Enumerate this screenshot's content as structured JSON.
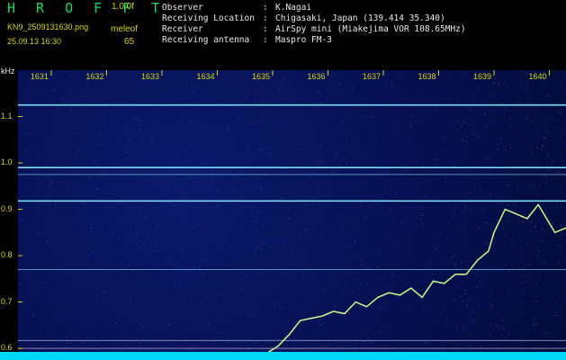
{
  "header": {
    "app_title": "H R O F F T",
    "version": "1.0.0f",
    "filename": "KN9_2509131630.png",
    "datetime": "25.09.13 16:30",
    "mode_label": "meleof",
    "mode_value": "65"
  },
  "info": [
    {
      "label": "Observer",
      "value": "K.Nagai"
    },
    {
      "label": "Receiving Location",
      "value": "Chigasaki, Japan (139.414 35.340)"
    },
    {
      "label": "Receiver",
      "value": "AirSpy mini (Miakejima VOR 108.65MHz)"
    },
    {
      "label": "Receiving antenna",
      "value": "Maspro FM-3"
    }
  ],
  "colors": {
    "background": "#000000",
    "plot_background": "#061052",
    "trace": "#c8ff80",
    "lines": "#80e8ff",
    "text_yellow": "#d8d800",
    "text_white": "#e8e8e8",
    "baseline": "#00d8f8"
  },
  "chart_data": {
    "type": "heatmap",
    "title": "",
    "xlabel": "",
    "ylabel": "kHz",
    "x_ticks": [
      "1631",
      "1632",
      "1633",
      "1634",
      "1635",
      "1636",
      "1637",
      "1638",
      "1639",
      "1640"
    ],
    "y_ticks": [
      "1.1",
      "1.0",
      "0.9",
      "0.8",
      "0.7",
      "0.6"
    ],
    "ylim": [
      0.575,
      1.2
    ],
    "xlim": [
      1630.4,
      1640.3
    ],
    "horizontal_lines_khz": [
      1.125,
      0.99,
      0.975,
      0.918,
      0.77,
      0.617,
      0.6
    ],
    "trace": {
      "x": [
        1634.7,
        1634.9,
        1635.1,
        1635.3,
        1635.5,
        1635.7,
        1635.9,
        1636.1,
        1636.3,
        1636.5,
        1636.7,
        1636.9,
        1637.1,
        1637.3,
        1637.5,
        1637.7,
        1637.9,
        1638.1,
        1638.3,
        1638.5,
        1638.7,
        1638.9,
        1639.0,
        1639.2,
        1639.4,
        1639.6,
        1639.8,
        1639.9,
        1640.1,
        1640.3
      ],
      "y": [
        0.585,
        0.59,
        0.605,
        0.63,
        0.66,
        0.665,
        0.67,
        0.68,
        0.675,
        0.7,
        0.69,
        0.71,
        0.72,
        0.715,
        0.73,
        0.71,
        0.745,
        0.74,
        0.76,
        0.76,
        0.79,
        0.81,
        0.85,
        0.9,
        0.89,
        0.88,
        0.91,
        0.89,
        0.85,
        0.86
      ]
    }
  }
}
